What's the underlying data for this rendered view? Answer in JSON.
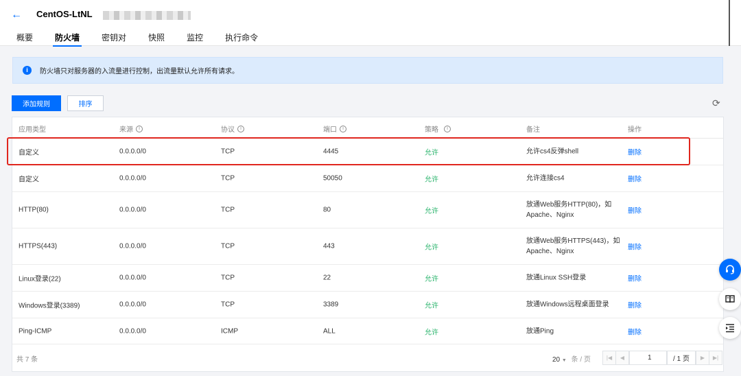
{
  "header": {
    "back_icon": "arrow-left-icon",
    "title": "CentOS-LtNL"
  },
  "tabs": [
    {
      "label": "概要"
    },
    {
      "label": "防火墙",
      "active": true
    },
    {
      "label": "密钥对"
    },
    {
      "label": "快照"
    },
    {
      "label": "监控"
    },
    {
      "label": "执行命令"
    }
  ],
  "notice": {
    "icon": "info-icon",
    "text": "防火墙只对服务器的入流量进行控制，出流量默认允许所有请求。"
  },
  "toolbar": {
    "add_label": "添加规则",
    "sort_label": "排序",
    "refresh_icon": "refresh-icon"
  },
  "table": {
    "columns": [
      "应用类型",
      "来源",
      "协议",
      "端口",
      "策略",
      "备注",
      "操作"
    ],
    "rows": [
      {
        "type": "自定义",
        "source": "0.0.0.0/0",
        "protocol": "TCP",
        "port": "4445",
        "policy": "允许",
        "note": "允许cs4反弹shell",
        "action": "删除"
      },
      {
        "type": "自定义",
        "source": "0.0.0.0/0",
        "protocol": "TCP",
        "port": "50050",
        "policy": "允许",
        "note": "允许连接cs4",
        "action": "删除"
      },
      {
        "type": "HTTP(80)",
        "source": "0.0.0.0/0",
        "protocol": "TCP",
        "port": "80",
        "policy": "允许",
        "note": "放通Web服务HTTP(80)，如Apache、Nginx",
        "action": "删除"
      },
      {
        "type": "HTTPS(443)",
        "source": "0.0.0.0/0",
        "protocol": "TCP",
        "port": "443",
        "policy": "允许",
        "note": "放通Web服务HTTPS(443)，如Apache、Nginx",
        "action": "删除"
      },
      {
        "type": "Linux登录(22)",
        "source": "0.0.0.0/0",
        "protocol": "TCP",
        "port": "22",
        "policy": "允许",
        "note": "放通Linux SSH登录",
        "action": "删除"
      },
      {
        "type": "Windows登录(3389)",
        "source": "0.0.0.0/0",
        "protocol": "TCP",
        "port": "3389",
        "policy": "允许",
        "note": "放通Windows远程桌面登录",
        "action": "删除"
      },
      {
        "type": "Ping-ICMP",
        "source": "0.0.0.0/0",
        "protocol": "ICMP",
        "port": "ALL",
        "policy": "允许",
        "note": "放通Ping",
        "action": "删除"
      }
    ]
  },
  "pagination": {
    "total": "共 7 条",
    "page_size": "20",
    "page_size_unit": "条 / 页",
    "current_page": "1",
    "total_pages": "/ 1 页"
  },
  "float_buttons": [
    {
      "icon": "headset-icon"
    },
    {
      "icon": "book-icon"
    },
    {
      "icon": "outline-list-icon"
    }
  ],
  "colors": {
    "accent": "#006eff",
    "allow": "#27b36a",
    "highlight": "#e0261e"
  }
}
